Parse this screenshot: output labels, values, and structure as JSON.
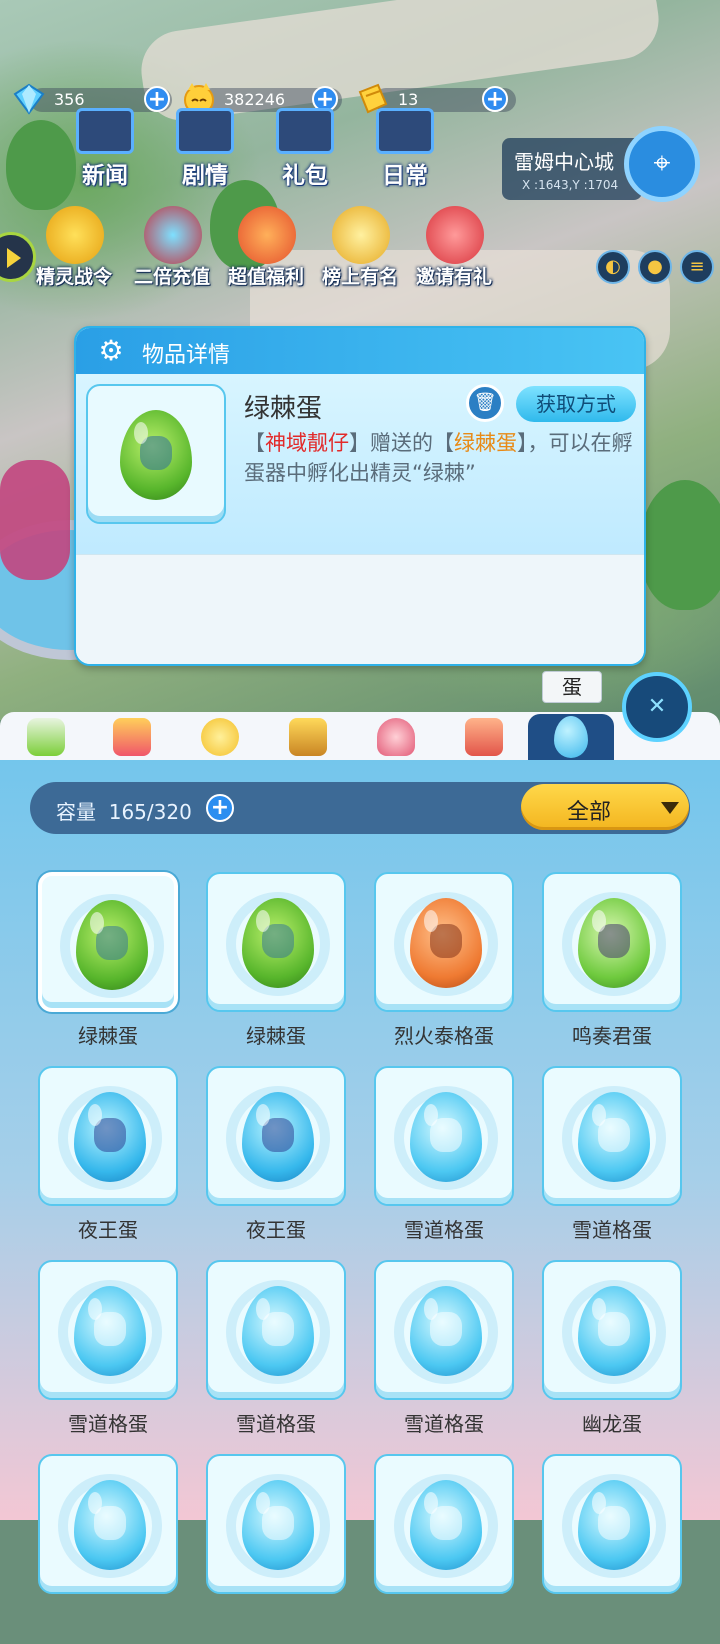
{
  "currency": [
    {
      "icon": "diamond-icon",
      "value": "356"
    },
    {
      "icon": "cat-coin-icon",
      "value": "382246"
    },
    {
      "icon": "gold-ticket-icon",
      "value": "13"
    }
  ],
  "features": [
    "新闻",
    "剧情",
    "礼包",
    "日常"
  ],
  "activities": [
    "精灵战令",
    "二倍充值",
    "超值福利",
    "榜上有名",
    "邀请有礼"
  ],
  "location": {
    "name": "雷姆中心城",
    "coord": "X :1643,Y :1704"
  },
  "detail": {
    "title": "物品详情",
    "item_name": "绿棘蛋",
    "get_button": "获取方式",
    "desc_parts": [
      "【",
      "神域靓仔",
      "】赠送的【",
      "绿棘蛋",
      "】，可以在孵蛋器中孵化出精灵“绿棘”"
    ]
  },
  "tabs": {
    "active_label": "蛋",
    "items": [
      "battery-icon",
      "blocks-icon",
      "star-wand-icon",
      "star-chest-icon",
      "dress-icon",
      "rocking-horse-icon",
      "egg-icon"
    ]
  },
  "bag": {
    "capacity_label": "容量",
    "capacity_value": "165/320",
    "filter": "全部",
    "items": [
      {
        "name": "绿棘蛋",
        "egg": "green"
      },
      {
        "name": "绿棘蛋",
        "egg": "green"
      },
      {
        "name": "烈火泰格蛋",
        "egg": "orange"
      },
      {
        "name": "鸣奏君蛋",
        "egg": "greenwhite"
      },
      {
        "name": "夜王蛋",
        "egg": "blue"
      },
      {
        "name": "夜王蛋",
        "egg": "blue"
      },
      {
        "name": "雪道格蛋",
        "egg": "ice"
      },
      {
        "name": "雪道格蛋",
        "egg": "ice"
      },
      {
        "name": "雪道格蛋",
        "egg": "ice"
      },
      {
        "name": "雪道格蛋",
        "egg": "ice"
      },
      {
        "name": "雪道格蛋",
        "egg": "ice"
      },
      {
        "name": "幽龙蛋",
        "egg": "ice"
      },
      {
        "name": "",
        "egg": "ice"
      },
      {
        "name": "",
        "egg": "ice"
      },
      {
        "name": "",
        "egg": "ice"
      },
      {
        "name": "",
        "egg": "ice"
      }
    ]
  },
  "colors": {
    "accent": "#2fb2e8",
    "panel": "#3d6a96",
    "filter": "#f3b51f",
    "highlight_red": "#e22a2a",
    "highlight_orange": "#e88a16"
  }
}
